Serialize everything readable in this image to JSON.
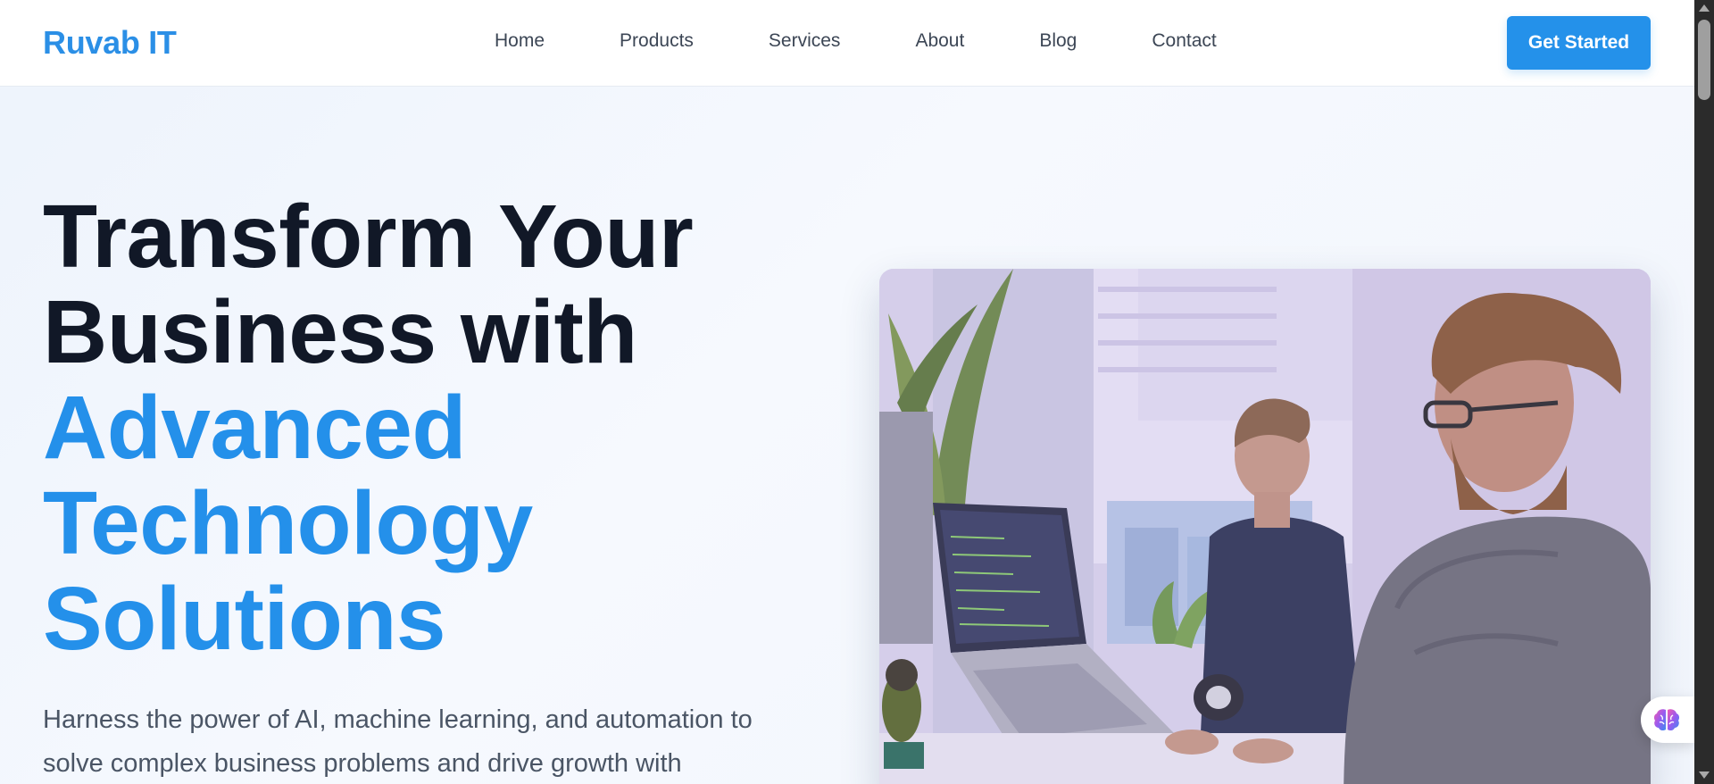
{
  "header": {
    "logo": "Ruvab IT",
    "nav": [
      "Home",
      "Products",
      "Services",
      "About",
      "Blog",
      "Contact"
    ],
    "cta_label": "Get Started"
  },
  "hero": {
    "title_lines": [
      "Transform Your",
      "Business with"
    ],
    "title_accent_lines": [
      "Advanced",
      "Technology",
      "Solutions"
    ],
    "description": "Harness the power of AI, machine learning, and automation to solve complex business problems and drive growth with"
  },
  "floating_button": {
    "icon": "brain-icon"
  },
  "colors": {
    "brand": "#2b8fe6",
    "accent": "#2490ea",
    "heading": "#111827",
    "body_text": "#4a5565"
  }
}
